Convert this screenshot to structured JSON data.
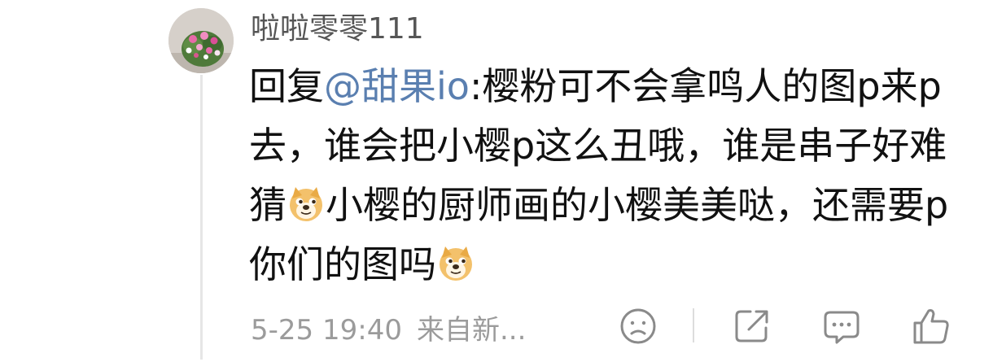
{
  "comment": {
    "username": "啦啦零零111",
    "reply_prefix": "回复",
    "mention": "@甜果io",
    "text_part1": ":樱粉可不会拿鸣人的图p来p去，谁会把小樱p这么丑哦，谁是串子好难猜",
    "text_part2": "小樱的厨师画的小樱美美哒，还需要p你们的图吗",
    "timestamp": "5-25 19:40",
    "source": "来自新..."
  },
  "icons": {
    "avatar": "flower-bouquet-avatar",
    "emoji": "doge-emoji",
    "actions": [
      "dislike-face-icon",
      "share-icon",
      "comment-icon",
      "like-thumb-icon"
    ]
  },
  "colors": {
    "mention": "#5a7fb0",
    "username": "#555555",
    "meta": "#9b9b9b",
    "icon": "#8a8a8a"
  }
}
